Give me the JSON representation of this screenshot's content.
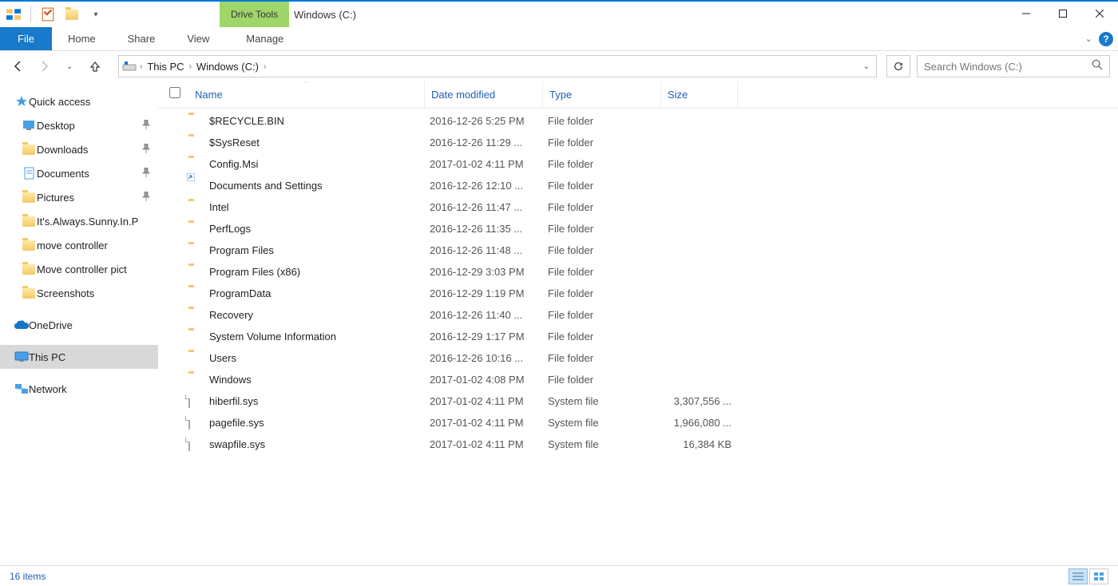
{
  "window": {
    "title": "Windows (C:)"
  },
  "contextual_tab": "Drive Tools",
  "ribbon": {
    "file": "File",
    "tabs": [
      "Home",
      "Share",
      "View",
      "Manage"
    ]
  },
  "breadcrumbs": [
    "This PC",
    "Windows (C:)"
  ],
  "search": {
    "placeholder": "Search Windows (C:)"
  },
  "sidebar": {
    "quick_access": {
      "label": "Quick access",
      "items": [
        {
          "label": "Desktop",
          "pinned": true,
          "icon": "desktop"
        },
        {
          "label": "Downloads",
          "pinned": true,
          "icon": "folder"
        },
        {
          "label": "Documents",
          "pinned": true,
          "icon": "document"
        },
        {
          "label": "Pictures",
          "pinned": true,
          "icon": "folder"
        },
        {
          "label": "It's.Always.Sunny.In.P",
          "pinned": false,
          "icon": "folder"
        },
        {
          "label": "move controller",
          "pinned": false,
          "icon": "folder"
        },
        {
          "label": "Move controller pict",
          "pinned": false,
          "icon": "folder"
        },
        {
          "label": "Screenshots",
          "pinned": false,
          "icon": "folder"
        }
      ]
    },
    "onedrive": {
      "label": "OneDrive"
    },
    "this_pc": {
      "label": "This PC"
    },
    "network": {
      "label": "Network"
    }
  },
  "columns": {
    "name": "Name",
    "date": "Date modified",
    "type": "Type",
    "size": "Size"
  },
  "files": [
    {
      "name": "$RECYCLE.BIN",
      "date": "2016-12-26 5:25 PM",
      "type": "File folder",
      "size": "",
      "icon": "folder"
    },
    {
      "name": "$SysReset",
      "date": "2016-12-26 11:29 ...",
      "type": "File folder",
      "size": "",
      "icon": "folder"
    },
    {
      "name": "Config.Msi",
      "date": "2017-01-02 4:11 PM",
      "type": "File folder",
      "size": "",
      "icon": "folder"
    },
    {
      "name": "Documents and Settings",
      "date": "2016-12-26 12:10 ...",
      "type": "File folder",
      "size": "",
      "icon": "folder-shortcut"
    },
    {
      "name": "Intel",
      "date": "2016-12-26 11:47 ...",
      "type": "File folder",
      "size": "",
      "icon": "folder"
    },
    {
      "name": "PerfLogs",
      "date": "2016-12-26 11:35 ...",
      "type": "File folder",
      "size": "",
      "icon": "folder"
    },
    {
      "name": "Program Files",
      "date": "2016-12-26 11:48 ...",
      "type": "File folder",
      "size": "",
      "icon": "folder"
    },
    {
      "name": "Program Files (x86)",
      "date": "2016-12-29 3:03 PM",
      "type": "File folder",
      "size": "",
      "icon": "folder"
    },
    {
      "name": "ProgramData",
      "date": "2016-12-29 1:19 PM",
      "type": "File folder",
      "size": "",
      "icon": "folder"
    },
    {
      "name": "Recovery",
      "date": "2016-12-26 11:40 ...",
      "type": "File folder",
      "size": "",
      "icon": "folder"
    },
    {
      "name": "System Volume Information",
      "date": "2016-12-29 1:17 PM",
      "type": "File folder",
      "size": "",
      "icon": "folder"
    },
    {
      "name": "Users",
      "date": "2016-12-26 10:16 ...",
      "type": "File folder",
      "size": "",
      "icon": "folder"
    },
    {
      "name": "Windows",
      "date": "2017-01-02 4:08 PM",
      "type": "File folder",
      "size": "",
      "icon": "folder"
    },
    {
      "name": "hiberfil.sys",
      "date": "2017-01-02 4:11 PM",
      "type": "System file",
      "size": "3,307,556 ...",
      "icon": "file"
    },
    {
      "name": "pagefile.sys",
      "date": "2017-01-02 4:11 PM",
      "type": "System file",
      "size": "1,966,080 ...",
      "icon": "file"
    },
    {
      "name": "swapfile.sys",
      "date": "2017-01-02 4:11 PM",
      "type": "System file",
      "size": "16,384 KB",
      "icon": "file"
    }
  ],
  "status": {
    "count": "16 items"
  }
}
